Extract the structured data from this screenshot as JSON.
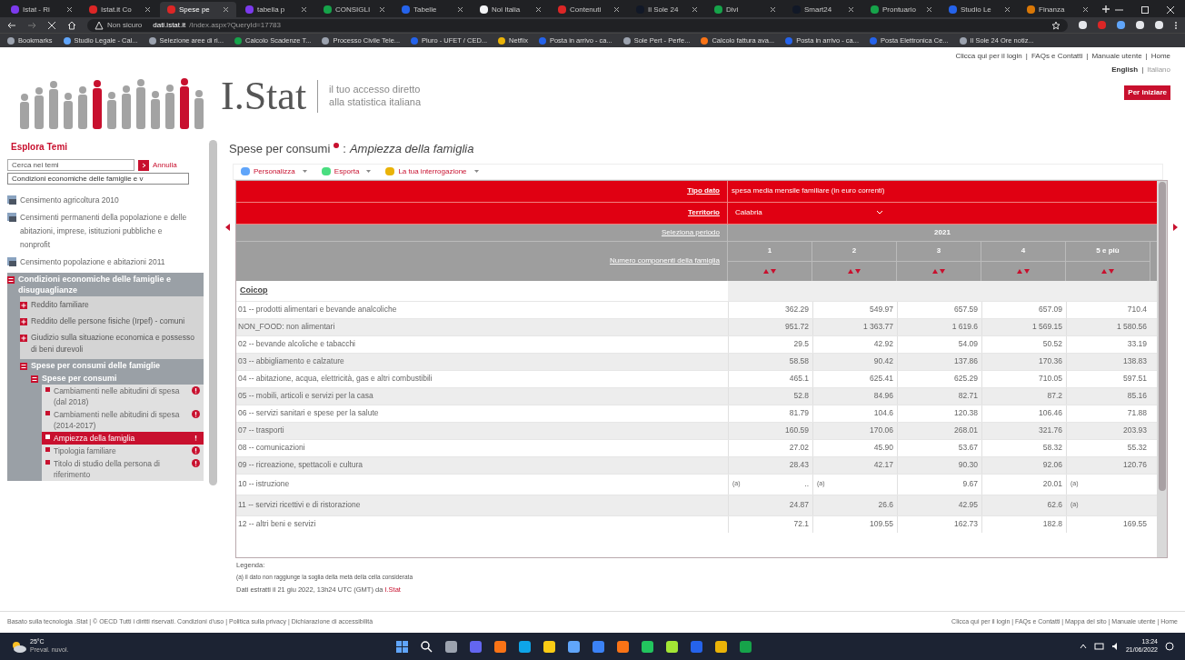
{
  "browser": {
    "tabs": [
      {
        "title": "Istat - Ri",
        "color": "#7c3aed",
        "selected": false
      },
      {
        "title": "Istat.it Co",
        "color": "#dc2626",
        "selected": false
      },
      {
        "title": "Spese pe",
        "color": "#dc2626",
        "selected": true
      },
      {
        "title": "tabella p",
        "color": "#7c3aed",
        "selected": false
      },
      {
        "title": "CONSIGLI",
        "color": "#16a34a",
        "selected": false
      },
      {
        "title": "Tabelle",
        "color": "#2563eb",
        "selected": false
      },
      {
        "title": "Noi Italia",
        "color": "#f3f4f6",
        "selected": false
      },
      {
        "title": "Contenuti",
        "color": "#dc2626",
        "selected": false
      },
      {
        "title": "Il Sole 24",
        "color": "#111827",
        "selected": false
      },
      {
        "title": "Divi",
        "color": "#16a34a",
        "selected": false
      },
      {
        "title": "Smart24",
        "color": "#111827",
        "selected": false
      },
      {
        "title": "Prontuario",
        "color": "#16a34a",
        "selected": false
      },
      {
        "title": "Studio Le",
        "color": "#2563eb",
        "selected": false
      },
      {
        "title": "Finanza",
        "color": "#d97706",
        "selected": false
      }
    ],
    "security": "Non sicuro",
    "url_host": "dati.istat.it",
    "url_path": "/Index.aspx?QueryId=17783",
    "bookmarks": [
      "Bookmarks",
      "Studio Legale - Cal...",
      "Selezione aree di ri...",
      "Calcolo Scadenze T...",
      "Processo Civile Tele...",
      "Piuro - UFET / CED...",
      "Netflix",
      "Posta in arrivo - ca...",
      "Sole Pert - Perfe...",
      "Calcolo fattura ava...",
      "Posta in arrivo - ca...",
      "Posta Elettronica Ce...",
      "Il Sole 24 Ore notiz..."
    ]
  },
  "header": {
    "brand": "I.Stat",
    "tagline": [
      "il tuo accesso diretto",
      "alla statistica italiana"
    ],
    "top_links": [
      "Clicca qui per il login",
      "FAQs e Contatti",
      "Manuale utente",
      "Home"
    ],
    "separator": "|",
    "languages": [
      {
        "label": "English",
        "selected": true
      },
      {
        "label": "Italiano",
        "selected": false
      }
    ],
    "start_button": "Per iniziare"
  },
  "sidebar": {
    "title": "Esplora Temi",
    "search_placeholder": "Cerca nei temi",
    "cancel": "Annulla",
    "theme_select": "Condizioni economiche delle famiglie e v",
    "items": [
      {
        "label": "Censimento agricoltura 2010",
        "expanded": false
      },
      {
        "label": "Censimenti permanenti della popolazione e delle abitazioni, imprese, istituzioni pubbliche e nonprofit",
        "expanded": false
      },
      {
        "label": "Censimento popolazione e abitazioni 2011",
        "expanded": false
      },
      {
        "label": "Condizioni economiche delle famiglie e disuguaglianze",
        "expanded": true,
        "children": [
          {
            "label": "Reddito familiare",
            "expanded": false
          },
          {
            "label": "Reddito delle persone fisiche (Irpef) - comuni",
            "expanded": false
          },
          {
            "label": "Giudizio sulla situazione economica e possesso di beni durevoli",
            "expanded": false
          },
          {
            "label": "Spese per consumi delle famiglie",
            "expanded": true,
            "children": [
              {
                "label": "Spese per consumi",
                "expanded": true,
                "children": [
                  {
                    "label": "Cambiamenti nelle abitudini di spesa (dal 2018)",
                    "selected": false
                  },
                  {
                    "label": "Cambiamenti nelle abitudini di spesa (2014-2017)",
                    "selected": false
                  },
                  {
                    "label": "Ampiezza della famiglia",
                    "selected": true
                  },
                  {
                    "label": "Tipologia familiare",
                    "selected": false
                  },
                  {
                    "label": "Titolo di studio della persona di riferimento",
                    "selected": false
                  }
                ]
              }
            ]
          }
        ]
      }
    ]
  },
  "main": {
    "title": "Spese per consumi",
    "separator": ":",
    "subtitle": "Ampiezza della famiglia",
    "toolbar": [
      "Personalizza",
      "Esporta",
      "La tua interrogazione"
    ],
    "filters": [
      {
        "label": "Tipo dato",
        "value": "spesa media mensile familiare (in euro correnti)",
        "kind": "text"
      },
      {
        "label": "Territorio",
        "value": "Calabria",
        "kind": "select"
      }
    ],
    "period": {
      "label": "Seleziona periodo",
      "value": "2021"
    },
    "dimension": {
      "label": "Numero componenti della famiglia",
      "columns": [
        "1",
        "2",
        "3",
        "4",
        "5 e più"
      ]
    },
    "row_header": "Coicop",
    "rows": [
      {
        "label": "01 -- prodotti alimentari e bevande analcoliche",
        "cells": [
          {
            "value": "362.29"
          },
          {
            "value": "549.97"
          },
          {
            "value": "657.59"
          },
          {
            "value": "657.09"
          },
          {
            "value": "710.4"
          }
        ]
      },
      {
        "label": "NON_FOOD: non alimentari",
        "cells": [
          {
            "value": "951.72"
          },
          {
            "value": "1 363.77"
          },
          {
            "value": "1 619.6"
          },
          {
            "value": "1 569.15"
          },
          {
            "value": "1 580.56"
          }
        ]
      },
      {
        "label": "02 -- bevande alcoliche e tabacchi",
        "cells": [
          {
            "value": "29.5"
          },
          {
            "value": "42.92"
          },
          {
            "value": "54.09"
          },
          {
            "value": "50.52"
          },
          {
            "value": "33.19"
          }
        ]
      },
      {
        "label": "03 -- abbigliamento e calzature",
        "cells": [
          {
            "value": "58.58"
          },
          {
            "value": "90.42"
          },
          {
            "value": "137.86"
          },
          {
            "value": "170.36"
          },
          {
            "value": "138.83"
          }
        ]
      },
      {
        "label": "04 -- abitazione, acqua, elettricità, gas e altri combustibili",
        "cells": [
          {
            "value": "465.1"
          },
          {
            "value": "625.41"
          },
          {
            "value": "625.29"
          },
          {
            "value": "710.05"
          },
          {
            "value": "597.51"
          }
        ]
      },
      {
        "label": "05 -- mobili, articoli e servizi per la casa",
        "cells": [
          {
            "value": "52.8"
          },
          {
            "value": "84.96"
          },
          {
            "value": "82.71"
          },
          {
            "value": "87.2"
          },
          {
            "value": "85.16"
          }
        ]
      },
      {
        "label": "06 -- servizi sanitari e spese per la salute",
        "cells": [
          {
            "value": "81.79"
          },
          {
            "value": "104.6"
          },
          {
            "value": "120.38"
          },
          {
            "value": "106.46"
          },
          {
            "value": "71.88"
          }
        ]
      },
      {
        "label": "07 -- trasporti",
        "cells": [
          {
            "value": "160.59"
          },
          {
            "value": "170.06"
          },
          {
            "value": "268.01"
          },
          {
            "value": "321.76"
          },
          {
            "value": "203.93"
          }
        ]
      },
      {
        "label": "08 -- comunicazioni",
        "cells": [
          {
            "value": "27.02"
          },
          {
            "value": "45.90"
          },
          {
            "value": "53.67"
          },
          {
            "value": "58.32"
          },
          {
            "value": "55.32"
          }
        ]
      },
      {
        "label": "09 -- ricreazione, spettacoli e cultura",
        "cells": [
          {
            "value": "28.43"
          },
          {
            "value": "42.17"
          },
          {
            "value": "90.30"
          },
          {
            "value": "92.06"
          },
          {
            "value": "120.76"
          }
        ]
      },
      {
        "label": "10 -- istruzione",
        "cells": [
          {
            "flag": "(a)",
            "value": ".."
          },
          {
            "flag": "(a)"
          },
          {
            "value": "9.67"
          },
          {
            "value": "20.01"
          },
          {
            "flag": "(a)"
          }
        ]
      },
      {
        "label": "11 -- servizi ricettivi e di ristorazione",
        "cells": [
          {
            "value": "24.87"
          },
          {
            "value": "26.6"
          },
          {
            "value": "42.95"
          },
          {
            "value": "62.6"
          },
          {
            "flag": "(a)"
          }
        ]
      },
      {
        "label": "12 -- altri beni e servizi",
        "cells": [
          {
            "value": "72.1"
          },
          {
            "value": "109.55"
          },
          {
            "value": "162.73"
          },
          {
            "value": "182.8"
          },
          {
            "value": "169.55"
          }
        ]
      }
    ],
    "legend_title": "Legenda:",
    "legend": "(a) il dato non raggiunge la soglia della metà della cella considerata",
    "extracted": "Dati estratti il 21 giu 2022, 13h24 UTC (GMT) da",
    "extracted_link": "I.Stat"
  },
  "footer": {
    "left": "Basato sulla tecnologia .Stat | © OECD Tutti i diritti riservati. Condizioni d'uso | Politica sulla privacy | Dichiarazione di accessibilità",
    "right": "Clicca qui per il login | FAQs e Contatti | Mappa del sito | Manuale utente | Home"
  },
  "taskbar": {
    "temperature": "25°C",
    "weather": "Preval. nuvol.",
    "time": "13:24",
    "date": "21/06/2022"
  }
}
